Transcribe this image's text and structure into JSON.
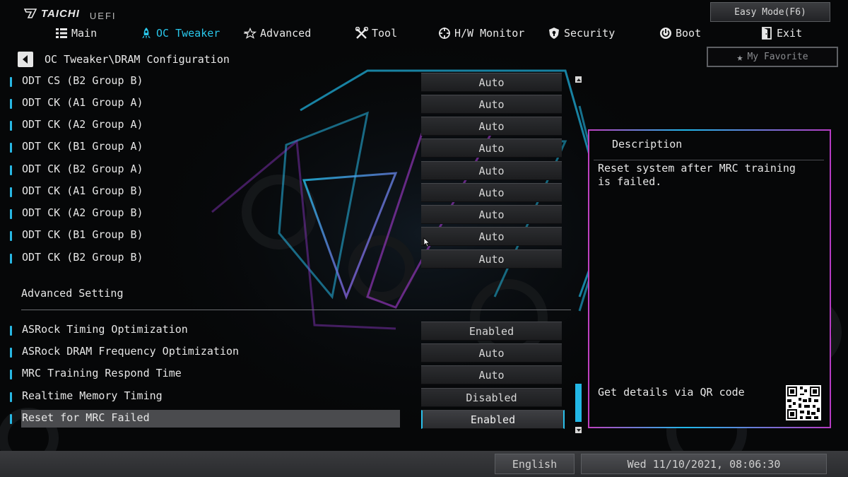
{
  "brand": {
    "logo": "TAICHI",
    "sub": "UEFI"
  },
  "header": {
    "easy_mode": "Easy Mode(F6)",
    "favorite": "My Favorite"
  },
  "nav": [
    {
      "label": "Main",
      "icon": "grid-list-icon",
      "active": false
    },
    {
      "label": "OC Tweaker",
      "icon": "rocket-icon",
      "active": true
    },
    {
      "label": "Advanced",
      "icon": "star-outline-icon",
      "active": false
    },
    {
      "label": "Tool",
      "icon": "wrench-screwdriver-icon",
      "active": false
    },
    {
      "label": "H/W Monitor",
      "icon": "crosshair-icon",
      "active": false
    },
    {
      "label": "Security",
      "icon": "shield-icon",
      "active": false
    },
    {
      "label": "Boot",
      "icon": "power-icon",
      "active": false
    },
    {
      "label": "Exit",
      "icon": "door-exit-icon",
      "active": false
    }
  ],
  "breadcrumb": "OC Tweaker\\DRAM Configuration",
  "settings_top": [
    {
      "label": "ODT CS (B2 Group B)",
      "value": "Auto"
    },
    {
      "label": "ODT CK (A1 Group A)",
      "value": "Auto"
    },
    {
      "label": "ODT CK (A2 Group A)",
      "value": "Auto"
    },
    {
      "label": "ODT CK (B1 Group A)",
      "value": "Auto"
    },
    {
      "label": "ODT CK (B2 Group A)",
      "value": "Auto"
    },
    {
      "label": "ODT CK (A1 Group B)",
      "value": "Auto"
    },
    {
      "label": "ODT CK (A2 Group B)",
      "value": "Auto"
    },
    {
      "label": "ODT CK (B1 Group B)",
      "value": "Auto"
    },
    {
      "label": "ODT CK (B2 Group B)",
      "value": "Auto"
    }
  ],
  "section": "Advanced Setting",
  "settings_adv": [
    {
      "label": "ASRock Timing Optimization",
      "value": "Enabled"
    },
    {
      "label": "ASRock DRAM Frequency Optimization",
      "value": "Auto"
    },
    {
      "label": "MRC Training Respond Time",
      "value": "Auto"
    },
    {
      "label": "Realtime Memory Timing",
      "value": "Disabled"
    },
    {
      "label": "Reset for MRC Failed",
      "value": "Enabled",
      "selected": true
    }
  ],
  "description": {
    "title": "Description",
    "text": "Reset system after MRC training is failed.",
    "qr_label": "Get details via QR code"
  },
  "footer": {
    "language": "English",
    "datetime": "Wed 11/10/2021, 08:06:30"
  },
  "colors": {
    "accent": "#29c6ea",
    "panel_border_magenta": "#b73bc4",
    "selected_row": "#4a4b4e"
  }
}
